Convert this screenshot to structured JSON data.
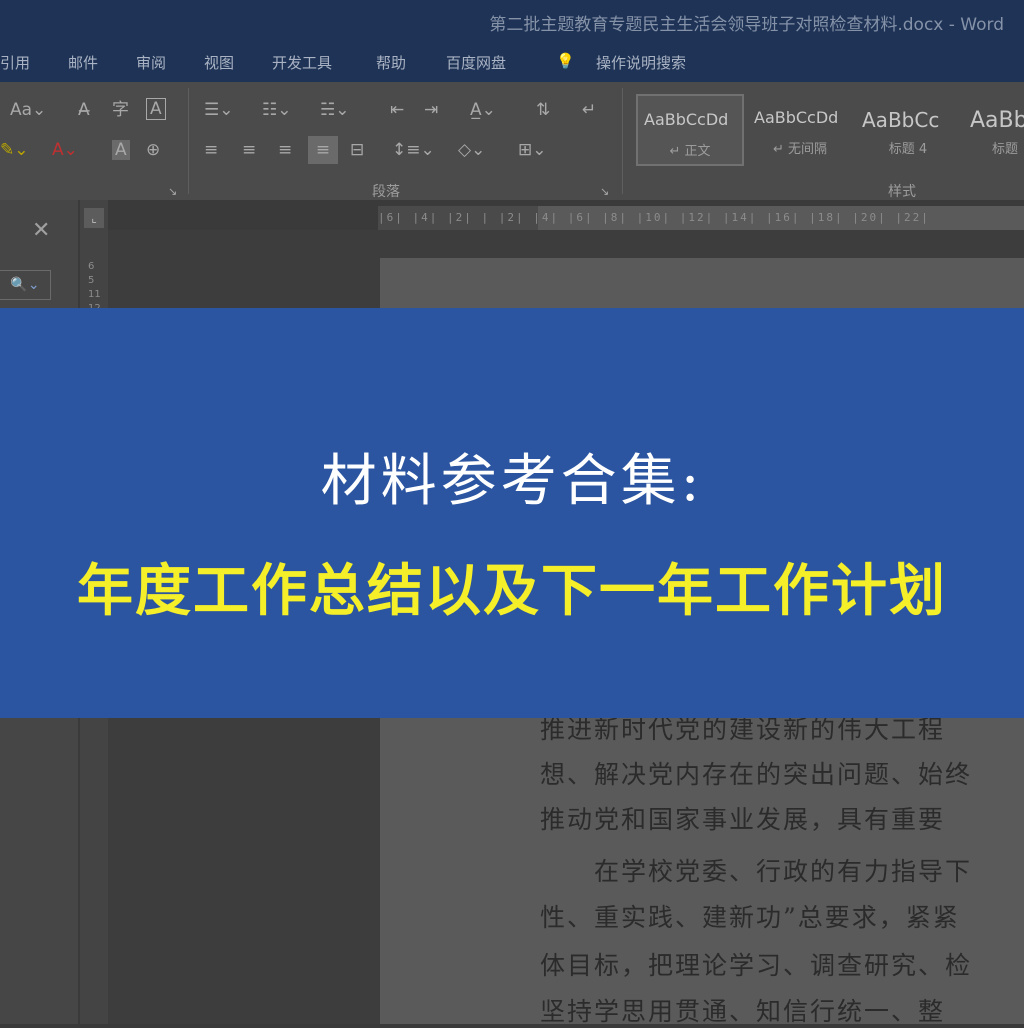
{
  "window": {
    "title": "第二批主题教育专题民主生活会领导班子对照检查材料.docx  -  Word"
  },
  "menu": {
    "items": [
      "引用",
      "邮件",
      "审阅",
      "视图",
      "开发工具",
      "帮助",
      "百度网盘"
    ],
    "tell_me": "操作说明搜索"
  },
  "ribbon": {
    "groups": {
      "paragraph": "段落",
      "styles": "样式"
    },
    "styles": [
      {
        "sample": "AaBbCcDd",
        "name": "↵ 正文"
      },
      {
        "sample": "AaBbCcDd",
        "name": "↵ 无间隔"
      },
      {
        "sample": "AaBbCc",
        "name": "标题 4"
      },
      {
        "sample": "AaBb",
        "name": "标题"
      }
    ]
  },
  "ruler": {
    "horizontal": "|6| |4| |2| |  |2| |4| |6| |8| |10| |12| |14| |16| |18| |20| |22|",
    "vertical": "6 5 11 12 13 14 15 16 17 18 19 20 21"
  },
  "document": {
    "lines": [
      "推进新时代党的建设新的伟大工程",
      "想、解决党内存在的突出问题、始终",
      "推动党和国家事业发展，具有重要",
      "　　在学校党委、行政的有力指导下",
      "性、重实践、建新功”总要求，紧紧",
      "体目标，把理论学习、调查研究、检",
      "坚持学思用贯通、知信行统一、整"
    ]
  },
  "banner": {
    "subtitle": "材料参考合集:",
    "title": "年度工作总结以及下一年工作计划"
  },
  "colors": {
    "banner_bg": "#2b55a0",
    "banner_title": "#f5ef2a",
    "titlebar": "#1e3356"
  }
}
